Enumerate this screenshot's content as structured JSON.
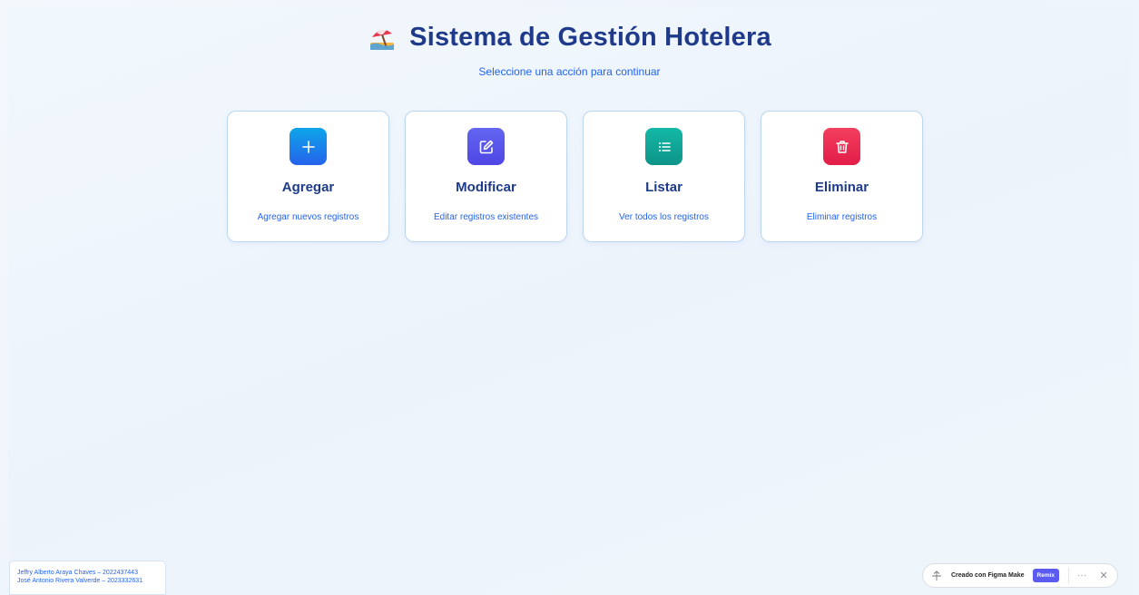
{
  "header": {
    "title": "Sistema de Gestión Hotelera",
    "subtitle": "Seleccione una acción para continuar",
    "logo_icon": "beach-umbrella-icon"
  },
  "actions": [
    {
      "title": "Agregar",
      "description": "Agregar nuevos registros",
      "icon": "plus-icon",
      "color": "#2563eb"
    },
    {
      "title": "Modificar",
      "description": "Editar registros existentes",
      "icon": "edit-icon",
      "color": "#4f46e5"
    },
    {
      "title": "Listar",
      "description": "Ver todos los registros",
      "icon": "list-icon",
      "color": "#0d9488"
    },
    {
      "title": "Eliminar",
      "description": "Eliminar registros",
      "icon": "trash-icon",
      "color": "#e11d48"
    }
  ],
  "credits": {
    "line1": "Jeffry Alberto Araya Chaves – 2022437443",
    "line2": "José Antonio Rivera Valverde – 2023332631"
  },
  "figma_badge": {
    "text": "Creado con Figma Make",
    "remix_label": "Remix",
    "more_icon": "ellipsis-icon",
    "close_icon": "close-icon",
    "accent": "#5b5bf0"
  }
}
